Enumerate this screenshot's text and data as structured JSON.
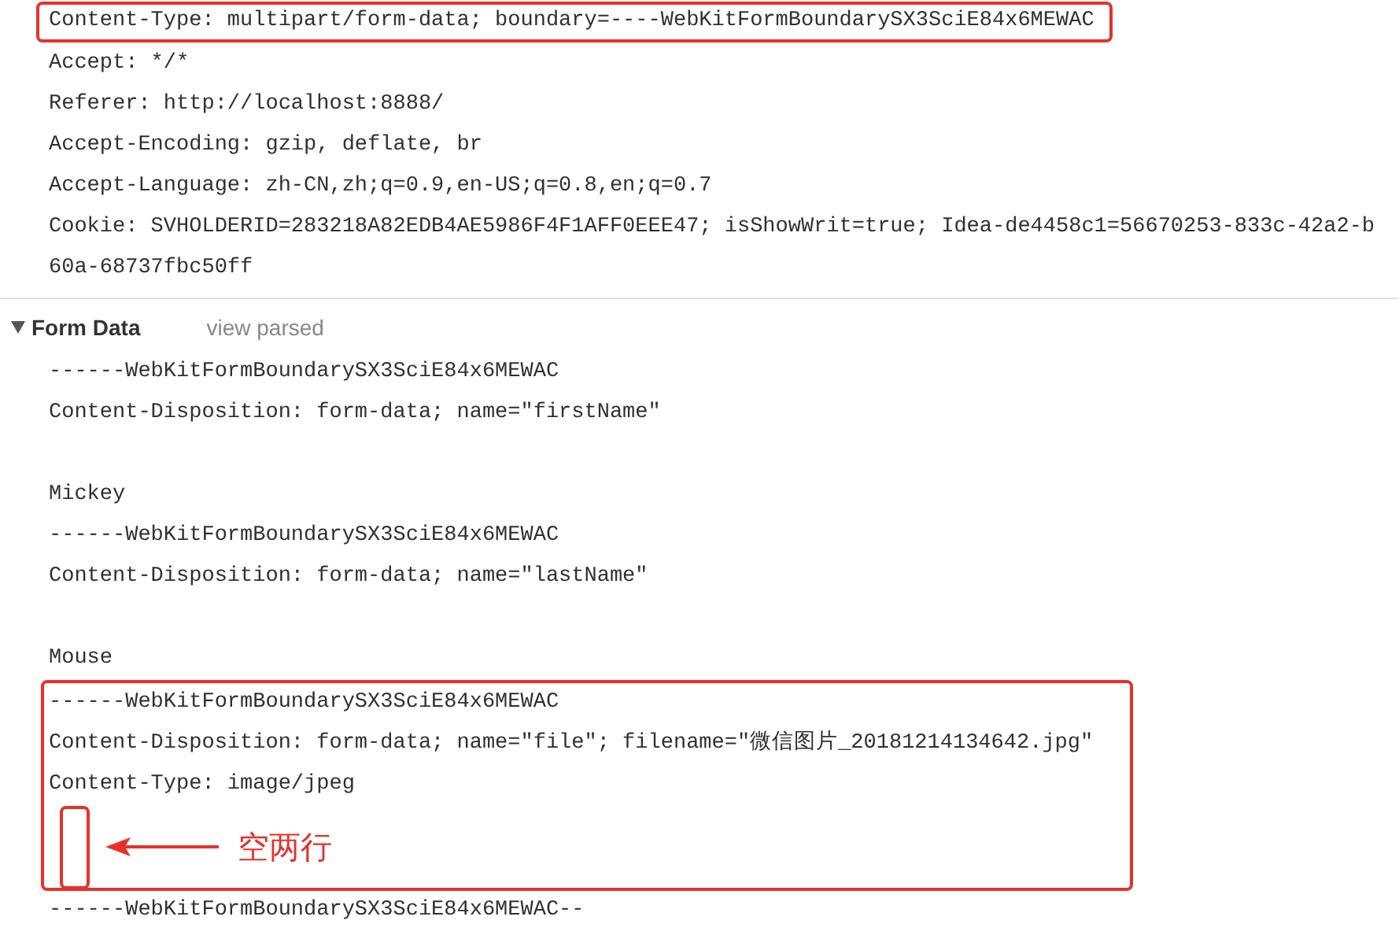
{
  "request_headers": [
    {
      "text": "Content-Type: multipart/form-data; boundary=----WebKitFormBoundarySX3SciE84x6MEWAC",
      "highlighted": true
    },
    {
      "text": "Accept: */*",
      "highlighted": false
    },
    {
      "text": "Referer: http://localhost:8888/",
      "highlighted": false
    },
    {
      "text": "Accept-Encoding: gzip, deflate, br",
      "highlighted": false
    },
    {
      "text": "Accept-Language: zh-CN,zh;q=0.9,en-US;q=0.8,en;q=0.7",
      "highlighted": false
    },
    {
      "text": "Cookie: SVHOLDERID=283218A82EDB4AE5986F4F1AFF0EEE47; isShowWrit=true; Idea-de4458c1=56670253-833c-42a2-b",
      "highlighted": false
    },
    {
      "text": "60a-68737fbc50ff",
      "highlighted": false
    }
  ],
  "form_data": {
    "title": "Form Data",
    "expanded": true,
    "view_link": "view parsed",
    "blocks": [
      {
        "highlighted": false,
        "lines": [
          {
            "kind": "text",
            "text": "------WebKitFormBoundarySX3SciE84x6MEWAC"
          },
          {
            "kind": "text",
            "text": "Content-Disposition: form-data; name=\"firstName\""
          },
          {
            "kind": "blank"
          },
          {
            "kind": "text",
            "text": "Mickey"
          },
          {
            "kind": "text",
            "text": "------WebKitFormBoundarySX3SciE84x6MEWAC"
          },
          {
            "kind": "text",
            "text": "Content-Disposition: form-data; name=\"lastName\""
          },
          {
            "kind": "blank"
          },
          {
            "kind": "text",
            "text": "Mouse"
          }
        ]
      },
      {
        "highlighted": true,
        "lines": [
          {
            "kind": "text",
            "text": "------WebKitFormBoundarySX3SciE84x6MEWAC"
          },
          {
            "kind": "text",
            "text": "Content-Disposition: form-data; name=\"file\"; filename=\"微信图片_20181214134642.jpg\""
          },
          {
            "kind": "text",
            "text": "Content-Type: image/jpeg"
          },
          {
            "kind": "gap_note",
            "note": "空两行"
          }
        ]
      },
      {
        "highlighted": false,
        "lines": [
          {
            "kind": "text",
            "text": "------WebKitFormBoundarySX3SciE84x6MEWAC--"
          }
        ]
      }
    ]
  }
}
